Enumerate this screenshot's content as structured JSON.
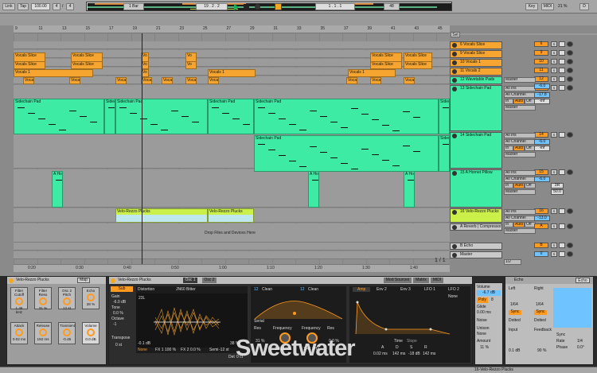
{
  "transport": {
    "link": "Link",
    "tap": "Tap",
    "tempo": "100.00",
    "sig_num": "4",
    "sig_den": "4",
    "quantize": "1 Bar",
    "position": "19 . 2 . 2",
    "arrangement_pos": "1 . 1 . 1",
    "cpu": "48",
    "key": "Key",
    "midi": "MIDI",
    "cpu_percent": "21 %",
    "d_label": "D"
  },
  "colors": {
    "orange": "#f6a630",
    "green": "#3deba4",
    "lime": "#cbf04a",
    "blue": "#bfe8ee",
    "accent": "#ff9a1e"
  },
  "ruler": {
    "bars": [
      "9",
      "11",
      "13",
      "15",
      "17",
      "19",
      "21",
      "23",
      "25",
      "27",
      "29",
      "31",
      "33",
      "35",
      "37",
      "39",
      "41",
      "43",
      "45"
    ],
    "times": [
      "0:20",
      "0:30",
      "0:40",
      "0:50",
      "1:00",
      "1:10",
      "1:20",
      "1:30",
      "1:40"
    ]
  },
  "clips": {
    "vocals_slice": "Vocals Slice",
    "vocals_1": "Vocals 1",
    "vocal": "Vocal",
    "vocal_short": "Vo",
    "sidechain_pad": "Sidechain Pad",
    "sidechain_pad_short": "Sidec",
    "hornet": "A Hor",
    "rezzo": "Velo-Rezzo Plucks",
    "drop_msg": "Drop Files and Devices Here"
  },
  "tracks": [
    {
      "name": "6 Vocals Slice",
      "num": "6",
      "color": "#f6a630"
    },
    {
      "name": "9 Vocals Slice",
      "num": "9",
      "color": "#f6a630"
    },
    {
      "name": "10 Vocals 1",
      "num": "10",
      "color": "#f6a630"
    },
    {
      "name": "11 Vocals 2",
      "num": "11",
      "color": "#f6a630"
    },
    {
      "name": "12 Wavetable Pads",
      "num": "12",
      "color": "#3deba4"
    },
    {
      "name": "13 Sidechain Pad",
      "num": "13",
      "color": "#3deba4"
    },
    {
      "name": "14 Sidechain Pad",
      "num": "14",
      "color": "#3deba4"
    },
    {
      "name": "15 A Hornet Pillow",
      "num": "15",
      "color": "#3deba4"
    },
    {
      "name": "16 Velo-Rezzo Plucks",
      "num": "16",
      "color": "#cbf04a"
    },
    {
      "name": "A Reverb | Compressor",
      "num": "A",
      "color": "#c9c9c9"
    },
    {
      "name": "B Echo",
      "num": "B",
      "color": "#c9c9c9"
    },
    {
      "name": "Master",
      "num": "0",
      "color": "#c9c9c9"
    }
  ],
  "mixer": {
    "master": "Master",
    "all_ins": "All Ins",
    "all_channels": "All Channel",
    "in": "In",
    "auto": "Auto",
    "off": "Off",
    "inf": "-inf",
    "s": "S",
    "c": "C",
    "vol_12": "-6.0",
    "vol_13": "-17.8",
    "vol_14": "-6.0",
    "vol_15": "-6.0",
    "vol_16": "-13.0",
    "pan_15": "3R",
    "send_15": "50.0",
    "set": "Set",
    "fraction": "1/2",
    "page": "1 / 1"
  },
  "device": {
    "rack_title": "Velo-Rezzo Plucks",
    "map": "Map",
    "macros": [
      {
        "name": "Filter\nCutoff",
        "value": "1.46 kHz"
      },
      {
        "name": "Filter\nReso",
        "value": "31 %"
      },
      {
        "name": "Osc 2\nPitch",
        "value": "12 st"
      },
      {
        "name": "Echo",
        "value": "28 %"
      },
      {
        "name": "Attack",
        "value": "0.02 ms"
      },
      {
        "name": "Release",
        "value": "192 ms"
      },
      {
        "name": "Transient",
        "value": "-0.45"
      },
      {
        "name": "Volume",
        "value": "0.0 dB"
      }
    ],
    "inst_title": "Velo-Rezzo Plucks",
    "osc1": "Osc 1",
    "osc2": "Osc 2",
    "sub": "Sub",
    "gain": "Gain",
    "gain_val": "-6.0 dB",
    "tone": "Tone",
    "tone_val": "0.0 %",
    "octave": "Octave",
    "octave_val": "-1",
    "transpose": "Transpose",
    "transpose_val": "0 st",
    "distortion": "Distortion",
    "wavetable": "JN60 Bitter",
    "position": "23L",
    "db_val": "-0.1 dB",
    "pct_38": "38 %",
    "none": "None",
    "fx1": "FX 1 100 %",
    "fx2": "FX 2 0.0 %",
    "semi": "Semi",
    "semi_val": "-12 st",
    "det": "Det",
    "det_val": "0 ct",
    "filter_clean": "Clean",
    "filter_num": "12",
    "serial": "Serial",
    "res": "Res",
    "res_val": "31 %",
    "frequency": "Frequency",
    "freq_val": "1.41 kHz",
    "freq2_val": "1.41 kHz",
    "res2_val": "0.0 %",
    "mod_tabs": [
      "Amp",
      "Env 2",
      "Env 3",
      "LFO 1",
      "LFO 2"
    ],
    "mod_sources": "Mod Sources",
    "matrix": "Matrix",
    "midi": "MIDI",
    "time": "Time",
    "slope": "Slope",
    "a": "A",
    "d": "D",
    "s": "S",
    "r": "R",
    "a_val": "0.02 ms",
    "d_val": "142 ms",
    "s_val": "-18 dB",
    "r_val": "142 ms",
    "volume": "Volume",
    "vol_val": "-6.7 dB",
    "poly": "Poly",
    "poly_val": "8",
    "glide": "Glide",
    "glide_val": "0.00 ms",
    "noise": "Noise",
    "unison": "Unison",
    "amount": "Amount",
    "amount_val": "11 %",
    "echo_title": "Echo",
    "left": "Left",
    "right": "Right",
    "sync": "Sync",
    "l_val": "1/64",
    "r_val2": "1/64",
    "dotted": "Dotted",
    "input": "Input",
    "input_val": "0.1 dB",
    "feedback": "Feedback",
    "fb_val": "90 %",
    "echo_tab": "Echo",
    "rate": "Rate",
    "rate_val": "1/4",
    "phase": "Phase",
    "phase_val": "0.0°"
  },
  "watermark": "Sweetwater",
  "status": "16-Velo-Rezzo Plucks"
}
